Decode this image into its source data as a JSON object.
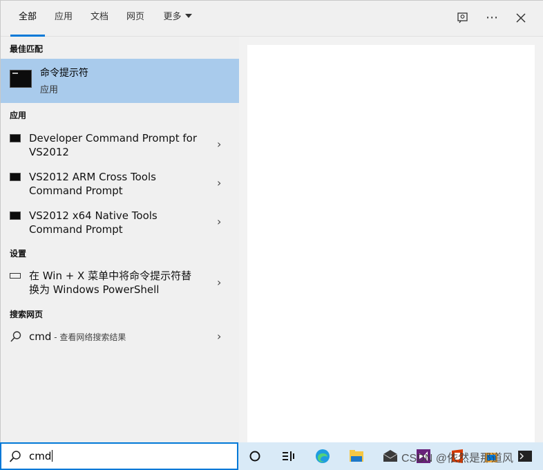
{
  "tabs": [
    {
      "label": "全部",
      "active": true
    },
    {
      "label": "应用",
      "active": false
    },
    {
      "label": "文档",
      "active": false
    },
    {
      "label": "网页",
      "active": false
    },
    {
      "label": "更多",
      "active": false
    }
  ],
  "top_icons": [
    "feedback-icon",
    "more-options-icon",
    "close-icon"
  ],
  "sections": {
    "best_match": "最佳匹配",
    "apps": "应用",
    "settings": "设置",
    "web": "搜索网页"
  },
  "best_match": {
    "title": "命令提示符",
    "subtitle": "应用"
  },
  "apps": [
    {
      "line1": "Developer Command Prompt for",
      "line2": "VS2012"
    },
    {
      "line1": "VS2012 ARM Cross Tools",
      "line2": "Command Prompt"
    },
    {
      "line1": "VS2012 x64 Native Tools",
      "line2": "Command Prompt"
    }
  ],
  "settings_item": {
    "line1": "在 Win + X 菜单中将命令提示符替",
    "line2": "换为 Windows PowerShell"
  },
  "web_item": {
    "query": "cmd",
    "suffix": " - 查看网络搜索结果"
  },
  "search": {
    "value": "cmd"
  },
  "taskbar_icons": [
    "cortana-circle-icon",
    "task-view-icon",
    "edge-icon",
    "file-explorer-icon",
    "mail-icon",
    "visual-studio-icon",
    "office-icon",
    "store-icon",
    "terminal-icon"
  ],
  "watermark": "CSDN @依然是那道风",
  "colors": {
    "accent": "#0078d7",
    "selected": "#a9cbec",
    "taskbar": "#d9eaf7"
  }
}
